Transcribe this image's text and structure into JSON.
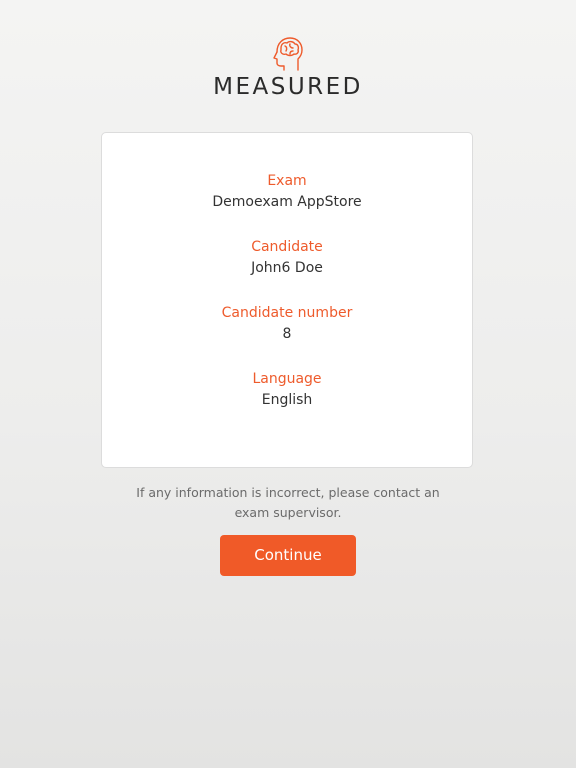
{
  "brand": {
    "icon": "brain-head-icon",
    "name": "MEASURED",
    "accent_color": "#f05a28"
  },
  "card": {
    "fields": [
      {
        "label": "Exam",
        "value": "Demoexam AppStore"
      },
      {
        "label": "Candidate",
        "value": "John6 Doe"
      },
      {
        "label": "Candidate number",
        "value": "8"
      },
      {
        "label": "Language",
        "value": "English"
      }
    ]
  },
  "notice": "If any information is incorrect, please contact an exam supervisor.",
  "continue_label": "Continue"
}
